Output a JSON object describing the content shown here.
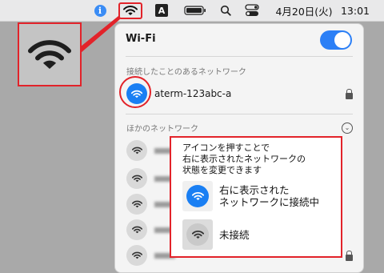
{
  "menubar": {
    "datetime": "4月20日(火)",
    "clock": "13:01",
    "ime_label": "A",
    "info_label": "i"
  },
  "panel": {
    "title": "Wi-Fi",
    "toggle_on": true,
    "known_section": "接続したことのあるネットワーク",
    "known_network": "aterm-123abc-a",
    "other_section": "ほかのネットワーク"
  },
  "callout": {
    "text_lines": [
      "アイコンを押すことで",
      "右に表示されたネットワークの",
      "状態を変更できます"
    ],
    "connected_lines": [
      "右に表示された",
      "ネットワークに接続中"
    ],
    "disconnected_label": "未接続"
  },
  "colors": {
    "accent": "#1a7ff3",
    "highlight": "#e2232a"
  },
  "icons": [
    "info-icon",
    "wifi-icon",
    "input-method-icon",
    "battery-icon",
    "search-icon",
    "control-center-icon",
    "lock-icon",
    "chevron-down-icon"
  ]
}
